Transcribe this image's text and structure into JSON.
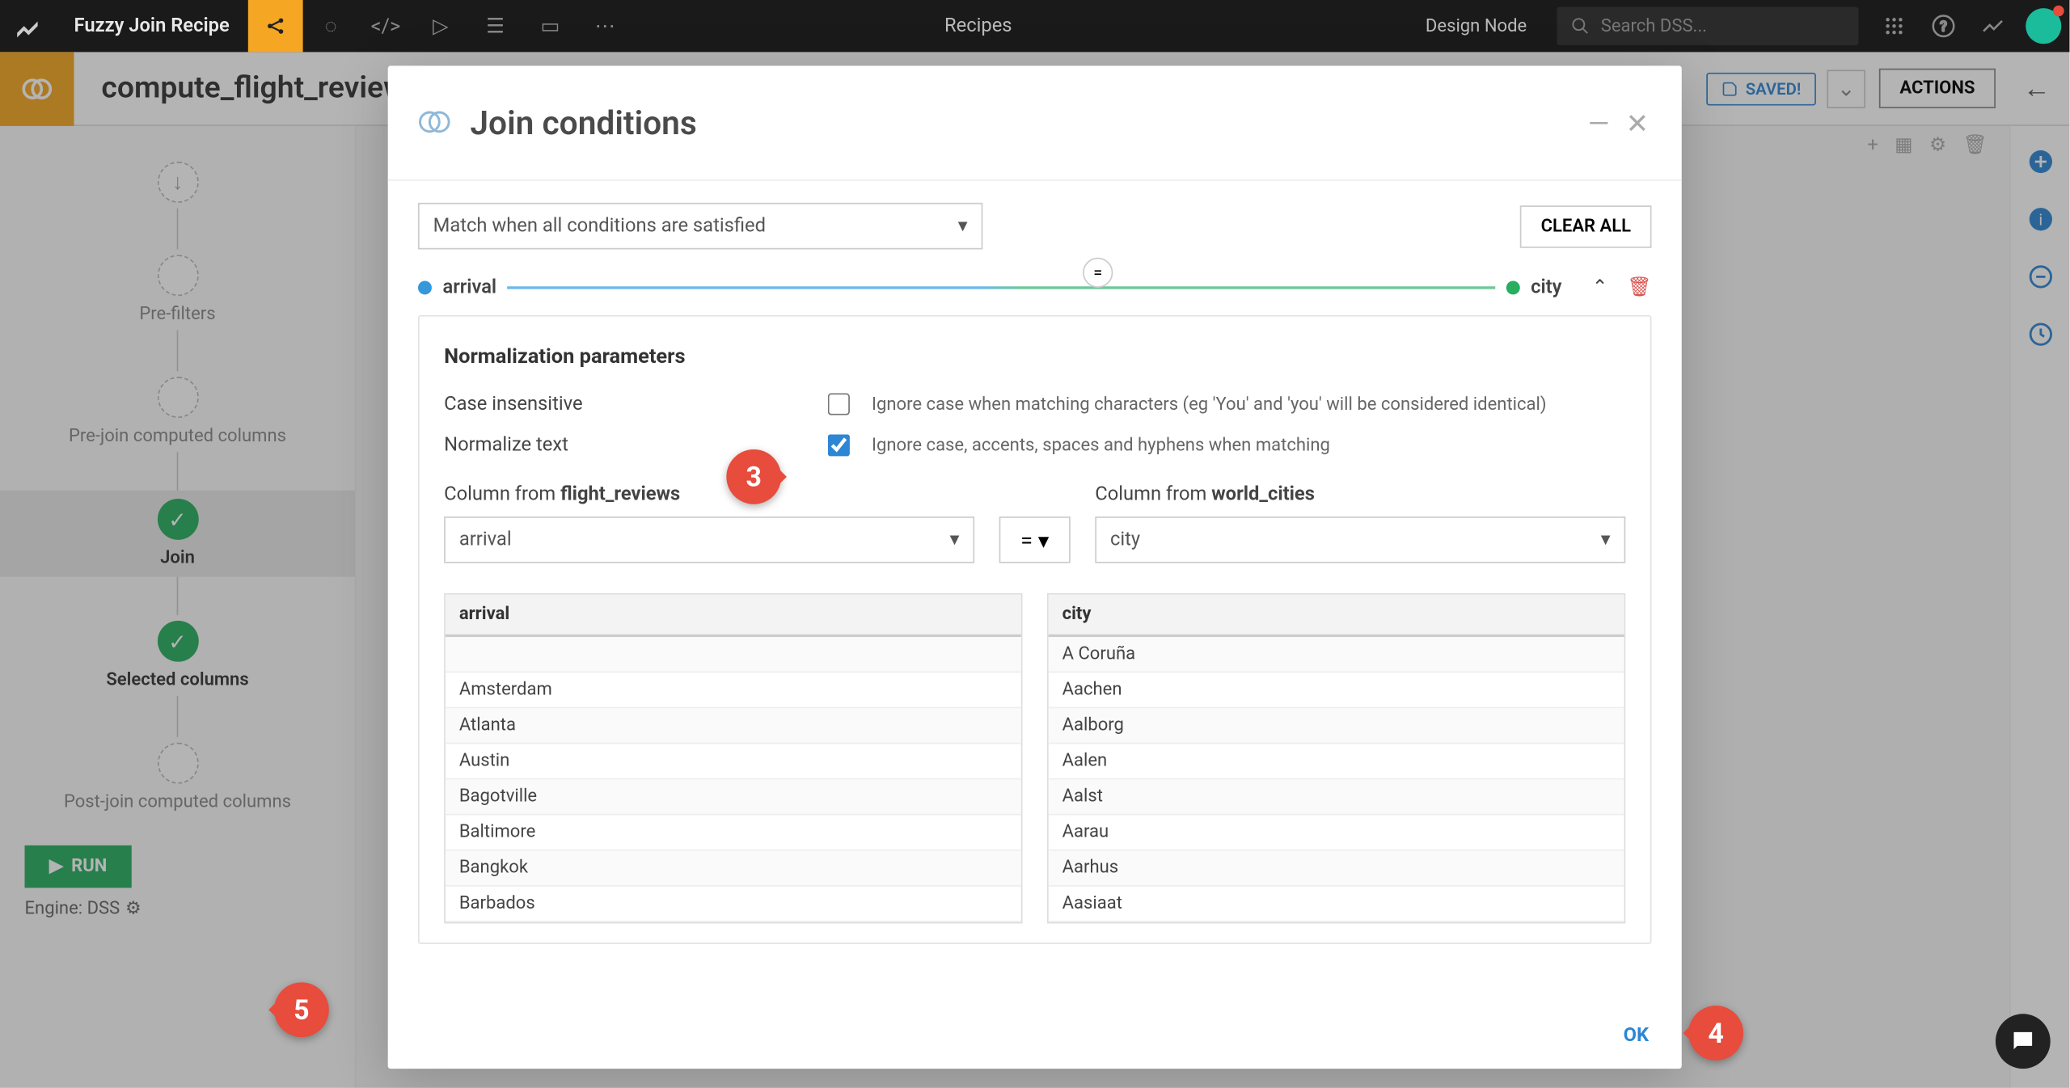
{
  "topbar": {
    "project_name": "Fuzzy Join Recipe",
    "center_label": "Recipes",
    "design_node": "Design Node",
    "search_placeholder": "Search DSS..."
  },
  "subhead": {
    "recipe_name": "compute_flight_reviews_by_airline_arrival",
    "saved_label": "SAVED!",
    "actions_label": "ACTIONS"
  },
  "sidebar": {
    "steps": {
      "pre_filters": "Pre-filters",
      "pre_join": "Pre-join computed columns",
      "join": "Join",
      "selected": "Selected columns",
      "post_join": "Post-join computed columns"
    },
    "run_label": "RUN",
    "engine_label": "Engine: DSS"
  },
  "modal": {
    "title": "Join conditions",
    "condition_mode": "Match when all conditions are satisfied",
    "clear_all": "CLEAR ALL",
    "left_col": "arrival",
    "right_col": "city",
    "eq_symbol": "=",
    "norm_title": "Normalization parameters",
    "case_insensitive_label": "Case insensitive",
    "case_insensitive_help": "Ignore case when matching characters (eg 'You' and 'you' will be considered identical)",
    "normalize_text_label": "Normalize text",
    "normalize_text_help": "Ignore case, accents, spaces and hyphens when matching",
    "left_col_label_prefix": "Column from ",
    "left_dataset": "flight_reviews",
    "right_col_label_prefix": "Column from ",
    "right_dataset": "world_cities",
    "left_selected": "arrival",
    "right_selected": "city",
    "op_value": "=",
    "ok_label": "OK"
  },
  "preview": {
    "left_header": "arrival",
    "left_rows": [
      "",
      "Amsterdam",
      "Atlanta",
      "Austin",
      "Bagotville",
      "Baltimore",
      "Bangkok",
      "Barbados"
    ],
    "right_header": "city",
    "right_rows": [
      "A Coruña",
      "Aachen",
      "Aalborg",
      "Aalen",
      "Aalst",
      "Aarau",
      "Aarhus",
      "Aasiaat"
    ]
  },
  "markers": {
    "m3": "3",
    "m4": "4",
    "m5": "5"
  }
}
